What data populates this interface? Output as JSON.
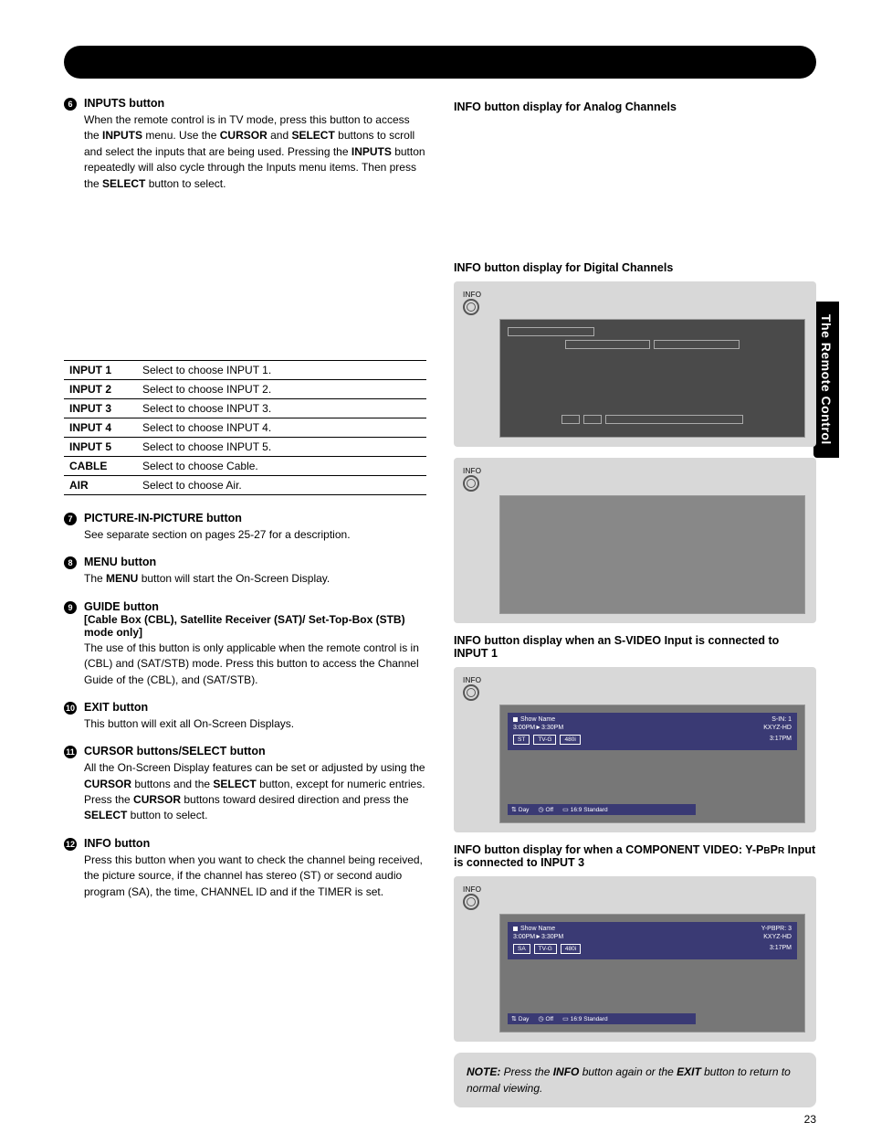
{
  "sideTab": "The Remote Control",
  "pageNumber": "23",
  "left": {
    "item6": {
      "num": "6",
      "title": "INPUTS button",
      "body_parts": [
        "When the remote control is in TV mode, press this button to access the ",
        "INPUTS",
        " menu. Use the ",
        "CURSOR",
        " and ",
        "SELECT",
        " buttons to scroll and select the inputs that are being used. Pressing the ",
        "INPUTS",
        " button repeatedly will also cycle through the Inputs menu items. Then press the ",
        "SELECT",
        " button to select."
      ]
    },
    "inputTable": [
      {
        "k": "INPUT 1",
        "v": "Select to choose INPUT 1."
      },
      {
        "k": "INPUT 2",
        "v": "Select to choose INPUT 2."
      },
      {
        "k": "INPUT 3",
        "v": "Select to choose INPUT 3."
      },
      {
        "k": "INPUT 4",
        "v": "Select to choose INPUT 4."
      },
      {
        "k": "INPUT 5",
        "v": "Select to choose INPUT 5."
      },
      {
        "k": "CABLE",
        "v": "Select to choose Cable."
      },
      {
        "k": "AIR",
        "v": "Select to choose Air."
      }
    ],
    "item7": {
      "num": "7",
      "title": "PICTURE-IN-PICTURE button",
      "body": "See separate section on pages 25-27 for a description."
    },
    "item8": {
      "num": "8",
      "title": "MENU button",
      "body_parts": [
        "The ",
        "MENU",
        " button will start the On-Screen Display."
      ]
    },
    "item9": {
      "num": "9",
      "title": "GUIDE button",
      "subtitle": "[Cable Box (CBL), Satellite Receiver (SAT)/ Set-Top-Box (STB) mode only]",
      "body": "The use of this button is only applicable when the remote control is in (CBL) and (SAT/STB) mode. Press this button to access the Channel Guide of the (CBL), and (SAT/STB)."
    },
    "item10": {
      "num": "10",
      "title": "EXIT button",
      "body": "This button will exit all On-Screen Displays."
    },
    "item11": {
      "num": "11",
      "title": "CURSOR buttons/SELECT button",
      "body_parts": [
        "All the On-Screen Display features can be set or adjusted by using the ",
        "CURSOR",
        " buttons and the ",
        "SELECT",
        " button, except for numeric entries. Press the ",
        "CURSOR",
        " buttons toward desired direction and press the ",
        "SELECT",
        " button to select."
      ]
    },
    "item12": {
      "num": "12",
      "title": "INFO button",
      "body": "Press this button when you want to check the channel being received, the picture source, if the channel has stereo (ST) or second audio program (SA), the time, CHANNEL ID and if the TIMER is set."
    }
  },
  "right": {
    "h_analog": "INFO button display for Analog Channels",
    "h_digital": "INFO button display for Digital Channels",
    "h_svideo": "INFO button display when an S-VIDEO Input is connected to INPUT 1",
    "h_component_a": "INFO button display for when a COMPONENT VIDEO: Y-P",
    "h_component_b": "B",
    "h_component_c": "P",
    "h_component_d": "R",
    "h_component_e": " Input is connected to INPUT 3",
    "infoLabel": "INFO",
    "osd_svideo": {
      "show": "Show Name",
      "time": "3:00PM►3:30PM",
      "tags": [
        "ST",
        "TV-G",
        "480i"
      ],
      "r1": "S-IN: 1",
      "r2": "KXYZ-HD",
      "r3": "3:17PM",
      "bottom": [
        "Day",
        "Off",
        "16:9 Standard"
      ]
    },
    "osd_component": {
      "show": "Show Name",
      "time": "3:00PM►3:30PM",
      "tags": [
        "SA",
        "TV-G",
        "480i"
      ],
      "r1": "Y-PBPR: 3",
      "r2": "KXYZ-HD",
      "r3": "3:17PM",
      "bottom": [
        "Day",
        "Off",
        "16:9 Standard"
      ]
    },
    "note_parts": [
      "NOTE:",
      " Press the ",
      "INFO",
      " button again or the ",
      "EXIT",
      " button to return to normal viewing."
    ]
  }
}
